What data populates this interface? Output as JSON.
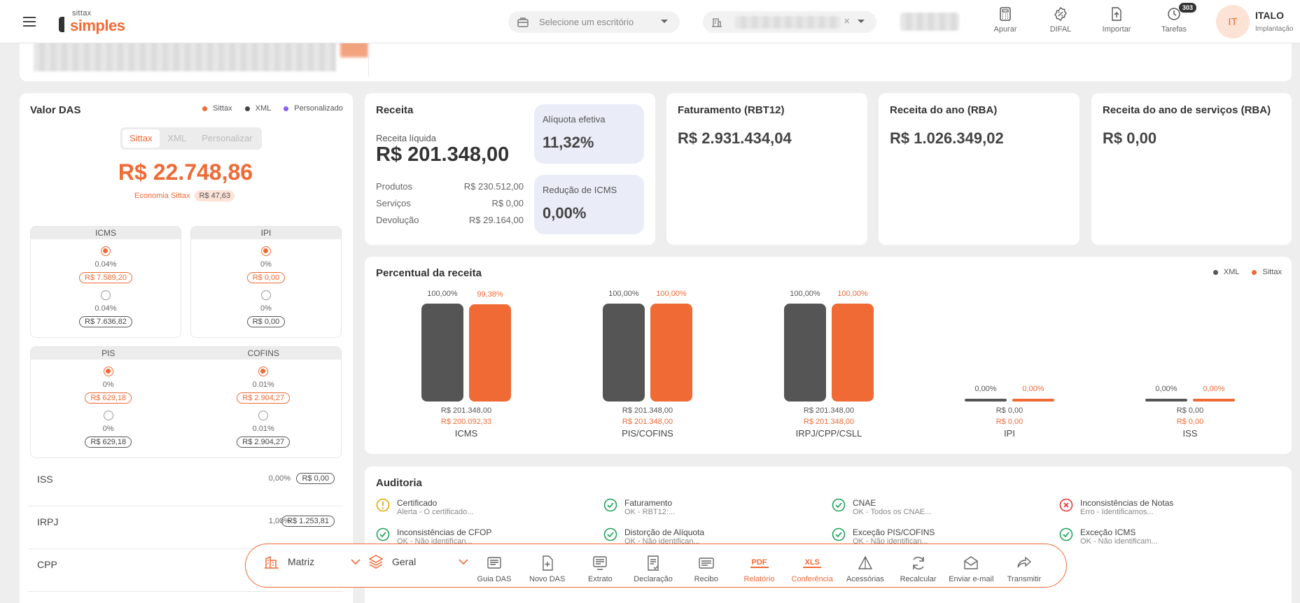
{
  "header": {
    "logo_small": "sittax",
    "logo_main": "simples",
    "office_select_placeholder": "Selecione um escritório",
    "company_select_clear": "×",
    "tools": [
      {
        "label": "Apurar",
        "icon": "calculator-icon"
      },
      {
        "label": "DIFAL",
        "icon": "percent-badge-icon"
      },
      {
        "label": "Importar",
        "icon": "upload-file-icon"
      },
      {
        "label": "Tarefas",
        "icon": "clock-icon",
        "badge": "303"
      }
    ],
    "avatar_initials": "IT",
    "user_name": "ITALO",
    "user_role": "Implantação"
  },
  "valor_das": {
    "title": "Valor DAS",
    "legend": [
      {
        "label": "Sittax",
        "color": "#f06a35"
      },
      {
        "label": "XML",
        "color": "#444444"
      },
      {
        "label": "Personalizado",
        "color": "#8b5cf6"
      }
    ],
    "tabs": [
      "Sittax",
      "XML",
      "Personalizar"
    ],
    "active_tab": "Sittax",
    "total": "R$ 22.748,86",
    "economia_label": "Economia Sittax",
    "economia_value": "R$ 47,63",
    "tax_boxes": [
      {
        "name": "ICMS",
        "sittax_pct": "0.04%",
        "sittax_value": "R$ 7.589,20",
        "xml_pct": "0.04%",
        "xml_value": "R$ 7.636,82"
      },
      {
        "name": "IPI",
        "sittax_pct": "0%",
        "sittax_value": "R$ 0,00",
        "xml_pct": "0%",
        "xml_value": "R$ 0,00"
      },
      {
        "name": "PIS",
        "sittax_pct": "0%",
        "sittax_value": "R$ 629,18",
        "xml_pct": "0%",
        "xml_value": "R$ 629,18"
      },
      {
        "name": "COFINS",
        "sittax_pct": "0.01%",
        "sittax_value": "R$ 2.904,27",
        "xml_pct": "0.01%",
        "xml_value": "R$ 2.904,27"
      }
    ],
    "rows": [
      {
        "label": "ISS",
        "pct": "0,00%",
        "value": "R$ 0,00"
      },
      {
        "label": "IRPJ",
        "pct": "1,00%",
        "value": "R$ 1.253,81"
      },
      {
        "label": "CPP",
        "pct": "",
        "value": ""
      }
    ]
  },
  "receita": {
    "title": "Receita",
    "liquida_label": "Receita líquida",
    "liquida_value": "R$ 201.348,00",
    "items": [
      {
        "label": "Produtos",
        "value": "R$ 230.512,00"
      },
      {
        "label": "Serviços",
        "value": "R$ 0,00"
      },
      {
        "label": "Devolução",
        "value": "R$ 29.164,00"
      }
    ],
    "aliquota_label": "Alíquota efetiva",
    "aliquota_value": "11,32%",
    "reducao_label": "Redução de ICMS",
    "reducao_value": "0,00%"
  },
  "kpis": [
    {
      "title": "Faturamento (RBT12)",
      "value": "R$ 2.931.434,04"
    },
    {
      "title": "Receita do ano (RBA)",
      "value": "R$ 1.026.349,02"
    },
    {
      "title": "Receita do ano de serviços (RBA)",
      "value": "R$ 0,00"
    }
  ],
  "chart_data": {
    "type": "bar",
    "title": "Percentual da receita",
    "legend_position": "top-right",
    "colors": {
      "XML": "#555555",
      "Sittax": "#f06a35"
    },
    "categories": [
      "ICMS",
      "PIS/COFINS",
      "IRPJ/CPP/CSLL",
      "IPI",
      "ISS"
    ],
    "series": [
      {
        "name": "XML",
        "values": [
          100,
          100,
          100,
          0,
          0
        ],
        "labels": [
          "100,00%",
          "100,00%",
          "100,00%",
          "0,00%",
          "0,00%"
        ],
        "amounts": [
          "R$ 201.348,00",
          "R$ 201.348,00",
          "R$ 201.348,00",
          "R$ 0,00",
          "R$ 0,00"
        ]
      },
      {
        "name": "Sittax",
        "values": [
          99.38,
          100,
          100,
          0,
          0
        ],
        "labels": [
          "99,38%",
          "100,00%",
          "100,00%",
          "0,00%",
          "0,00%"
        ],
        "amounts": [
          "R$ 200.092,33",
          "R$ 201.348,00",
          "R$ 201.348,00",
          "R$ 0,00",
          "R$ 0,00"
        ]
      }
    ],
    "ylim": [
      0,
      100
    ]
  },
  "auditoria": {
    "title": "Auditoria",
    "items": [
      {
        "title": "Certificado",
        "status": "Alerta - O certificado...",
        "state": "warning"
      },
      {
        "title": "Faturamento",
        "status": "OK - RBT12:...",
        "state": "ok"
      },
      {
        "title": "CNAE",
        "status": "OK - Todos os CNAE...",
        "state": "ok"
      },
      {
        "title": "Inconsistências de Notas",
        "status": "Erro - Identificamos...",
        "state": "error"
      },
      {
        "title": "Inconsistências de CFOP",
        "status": "OK - Não identifican...",
        "state": "ok"
      },
      {
        "title": "Distorção de Alíquota",
        "status": "OK - Não identifican...",
        "state": "ok"
      },
      {
        "title": "Exceção PIS/COFINS",
        "status": "OK - Não identifican...",
        "state": "ok"
      },
      {
        "title": "Exceção ICMS",
        "status": "OK - Não identificam...",
        "state": "ok"
      }
    ]
  },
  "dock": {
    "matriz_label": "Matriz",
    "geral_label": "Geral",
    "actions": [
      {
        "label": "Guia DAS",
        "icon": "das-guide-icon",
        "accent": false
      },
      {
        "label": "Novo DAS",
        "icon": "new-file-icon",
        "accent": false
      },
      {
        "label": "Extrato",
        "icon": "statement-icon",
        "accent": false
      },
      {
        "label": "Declaração",
        "icon": "declaration-icon",
        "accent": false
      },
      {
        "label": "Recibo",
        "icon": "receipt-icon",
        "accent": false
      },
      {
        "label": "Relatório",
        "icon": "pdf-icon",
        "accent": true,
        "tag": "PDF"
      },
      {
        "label": "Conferência",
        "icon": "xls-icon",
        "accent": true,
        "tag": "XLS"
      },
      {
        "label": "Acessórias",
        "icon": "triangle-icon",
        "accent": false
      },
      {
        "label": "Recalcular",
        "icon": "refresh-icon",
        "accent": false
      },
      {
        "label": "Enviar e-mail",
        "icon": "mail-icon",
        "accent": false
      },
      {
        "label": "Transmitir",
        "icon": "share-icon",
        "accent": false
      }
    ]
  }
}
